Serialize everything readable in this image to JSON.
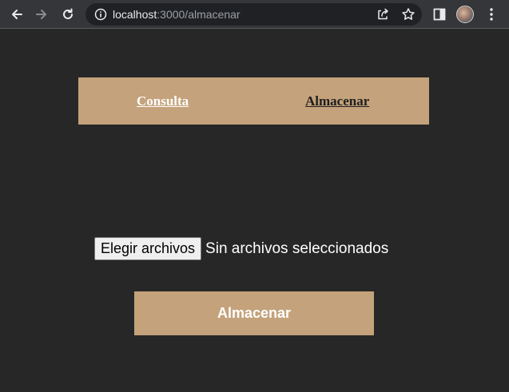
{
  "browser": {
    "url_host": "localhost",
    "url_path": ":3000/almacenar",
    "icons": {
      "back": "arrow-left",
      "forward": "arrow-right",
      "reload": "reload",
      "site_info": "info-circle",
      "share": "share",
      "bookmark": "star-outline",
      "side_panel": "side-panel",
      "profile": "avatar",
      "menu": "kebab-menu"
    }
  },
  "navbar": {
    "background": "#c4a27b",
    "links": {
      "consulta": "Consulta",
      "almacenar": "Almacenar"
    }
  },
  "upload": {
    "choose_button_label": "Elegir archivos",
    "status_text": "Sin archivos seleccionados"
  },
  "submit": {
    "label": "Almacenar",
    "background": "#c4a27b"
  },
  "colors": {
    "page_background": "#272727",
    "accent": "#c4a27b"
  }
}
